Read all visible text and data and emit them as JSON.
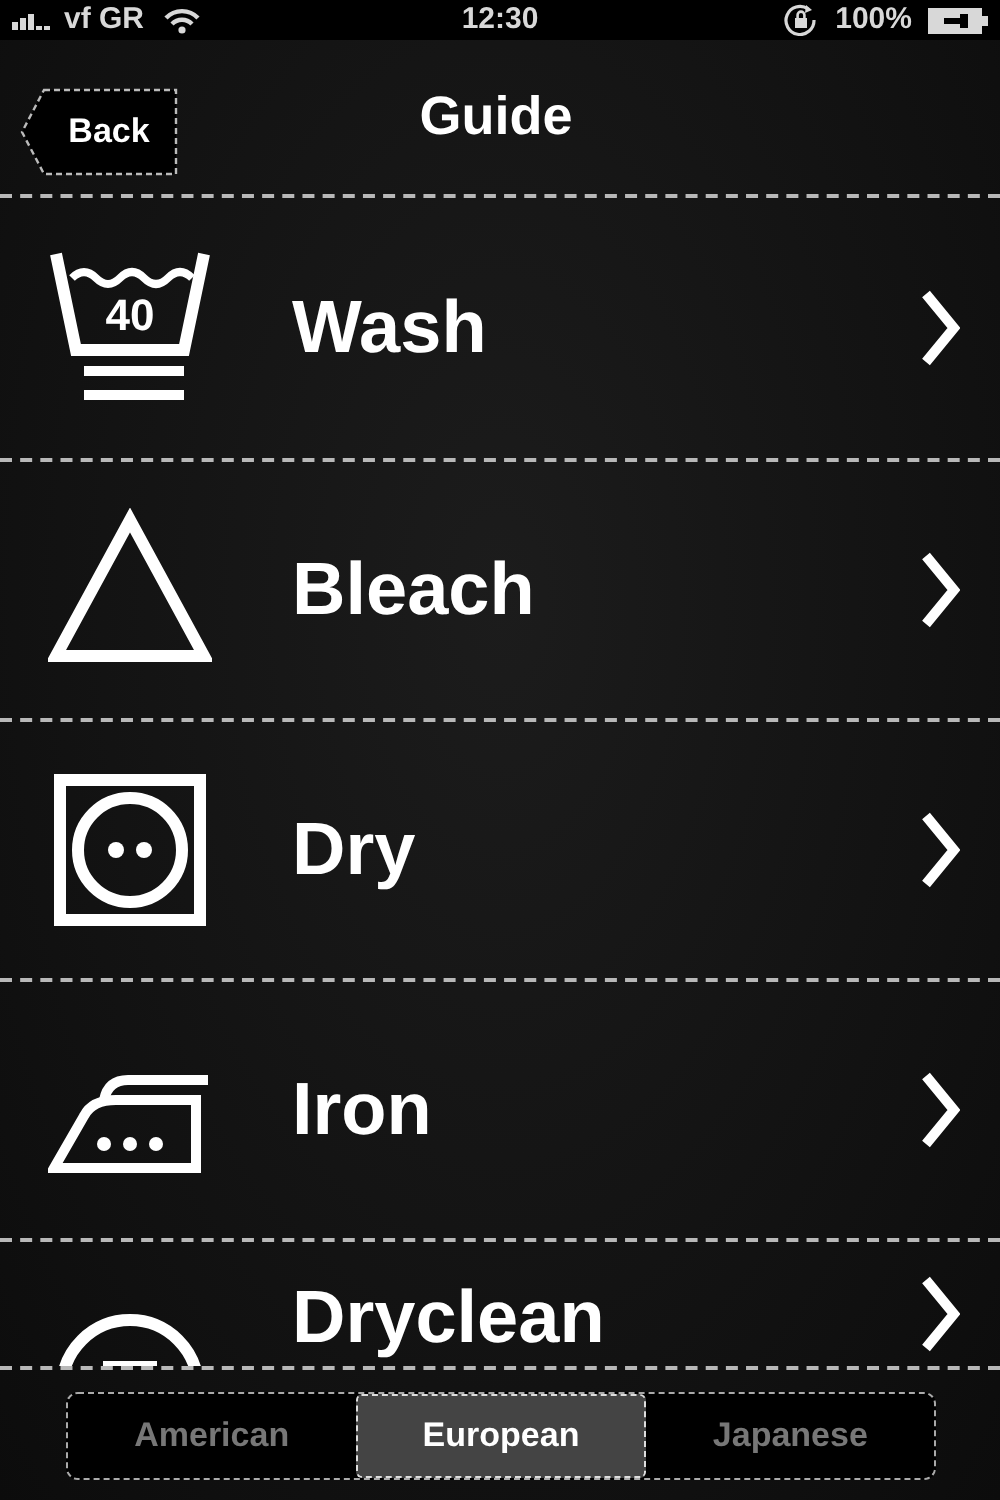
{
  "status_bar": {
    "carrier": "vf GR",
    "time": "12:30",
    "battery": "100%"
  },
  "nav_bar": {
    "back_button": "Back",
    "title": "Guide"
  },
  "items": [
    {
      "kind": "wash",
      "label": "Wash",
      "temperature": "40"
    },
    {
      "kind": "bleach",
      "label": "Bleach"
    },
    {
      "kind": "dry",
      "label": "Dry"
    },
    {
      "kind": "iron",
      "label": "Iron"
    },
    {
      "kind": "dryclean",
      "label": "Dryclean"
    }
  ],
  "segments": [
    {
      "label": "American",
      "selected": false
    },
    {
      "label": "European",
      "selected": true
    },
    {
      "label": "Japanese",
      "selected": false
    }
  ]
}
